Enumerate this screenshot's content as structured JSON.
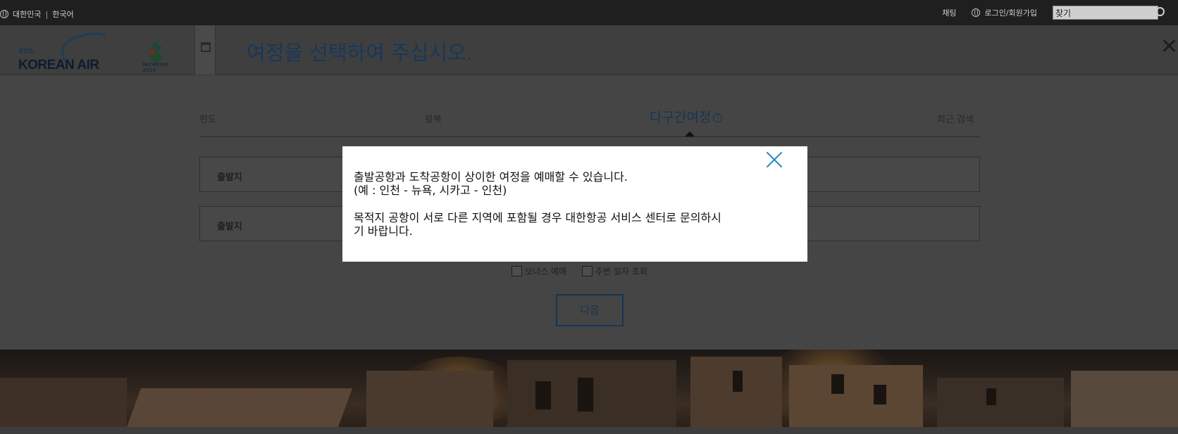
{
  "topbar": {
    "country": "대한민국",
    "divider": "|",
    "language": "한국어",
    "recruit": "채팅",
    "login": "로그인/회원가입",
    "search_value": "찾기"
  },
  "header": {
    "logo_text": "KOREAN AIR",
    "logo_45": "45th",
    "asian_games": "INCHEON 2014",
    "title": "여정을 선택하여 주십시오."
  },
  "tabs": [
    {
      "label": "편도"
    },
    {
      "label": "왕복"
    },
    {
      "label": "다구간여정",
      "help": "?"
    },
    {
      "label": "최근 검색"
    }
  ],
  "rows": [
    {
      "label": "출발지"
    },
    {
      "label": "출발지"
    }
  ],
  "options": [
    {
      "label": "보너스 예매"
    },
    {
      "label": "주변 일자 조회"
    }
  ],
  "next_label": "다음",
  "modal": {
    "line1": "출발공항과 도착공항이 상이한 여정을 예매할 수 있습니다.",
    "line2": "(예 : 인천 - 뉴욕, 시카고 - 인천)",
    "line3": "목적지 공항이 서로 다른 지역에 포함될 경우 대한항공 서비스 센터로 문의하시",
    "line4": "기 바랍니다."
  },
  "colors": {
    "accent": "#163552",
    "modal_close": "#2a8cc0",
    "overlay": "#454545"
  }
}
